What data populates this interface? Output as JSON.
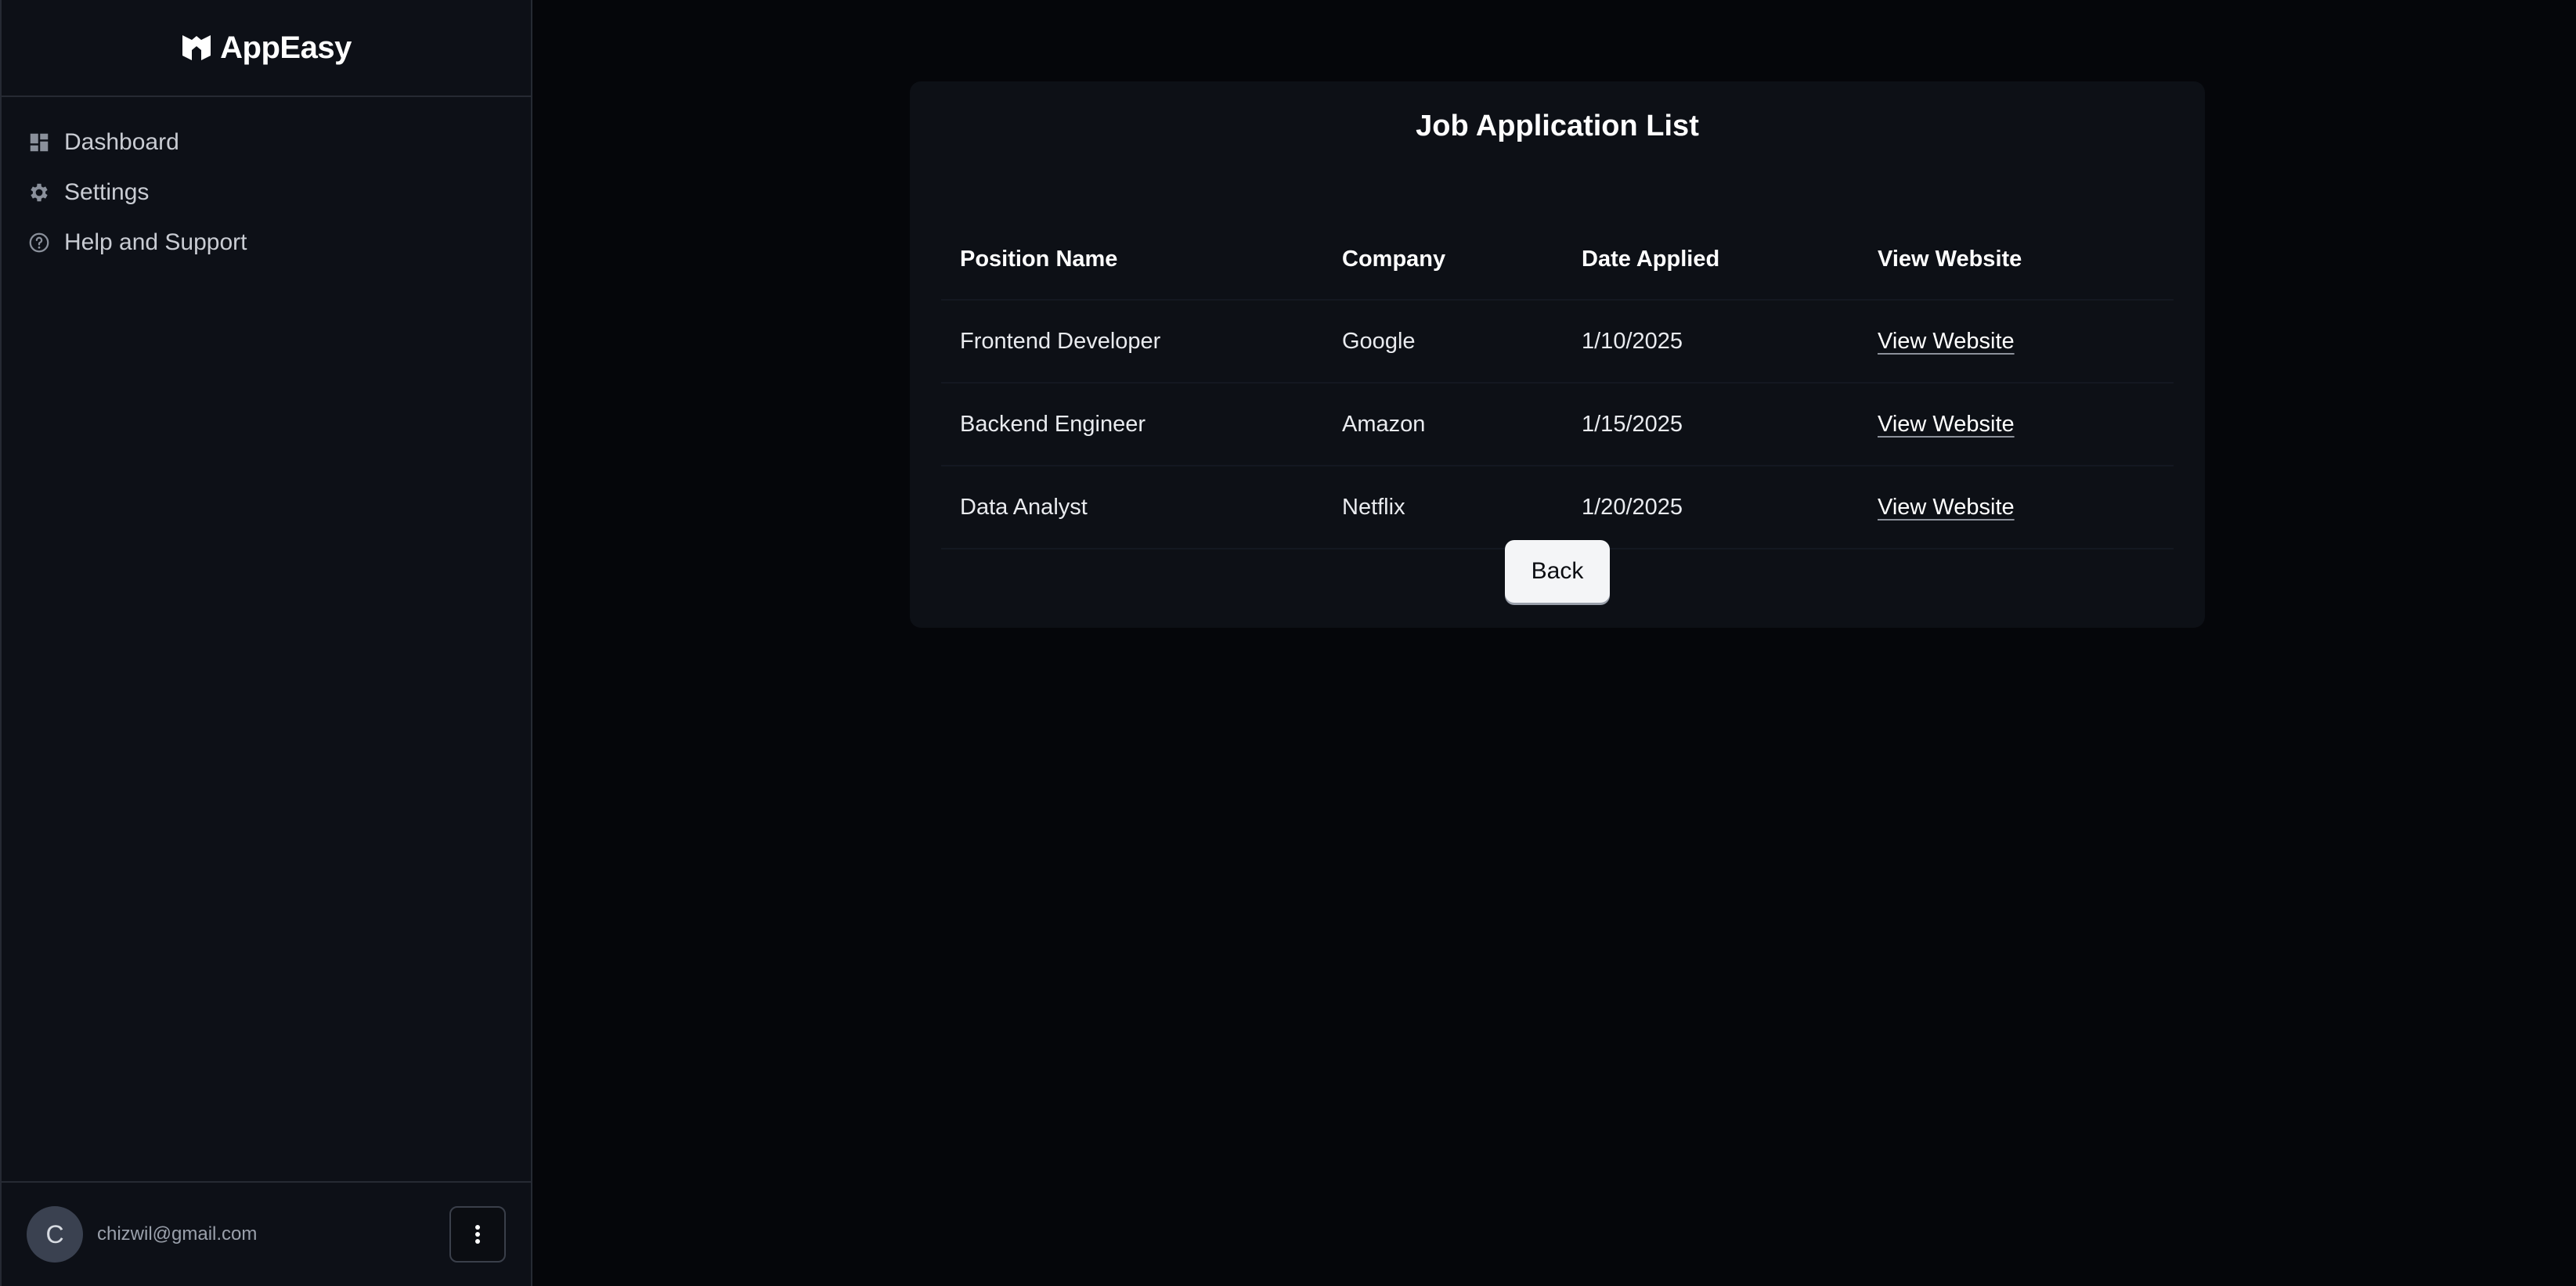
{
  "app": {
    "name": "AppEasy"
  },
  "sidebar": {
    "items": [
      {
        "label": "Dashboard",
        "icon": "dashboard-icon"
      },
      {
        "label": "Settings",
        "icon": "gear-icon"
      },
      {
        "label": "Help and Support",
        "icon": "help-circle-icon"
      }
    ]
  },
  "user": {
    "initial": "C",
    "email": "chizwil@gmail.com"
  },
  "main": {
    "title": "Job Application List",
    "columns": [
      "Position Name",
      "Company",
      "Date Applied",
      "View Website"
    ],
    "rows": [
      {
        "position": "Frontend Developer",
        "company": "Google",
        "date": "1/10/2025",
        "link": "View Website"
      },
      {
        "position": "Backend Engineer",
        "company": "Amazon",
        "date": "1/15/2025",
        "link": "View Website"
      },
      {
        "position": "Data Analyst",
        "company": "Netflix",
        "date": "1/20/2025",
        "link": "View Website"
      }
    ],
    "back_label": "Back"
  },
  "colors": {
    "background": "#05060a",
    "sidebar": "#0d1017",
    "card": "#0d1016",
    "button": "#f4f5f7"
  }
}
